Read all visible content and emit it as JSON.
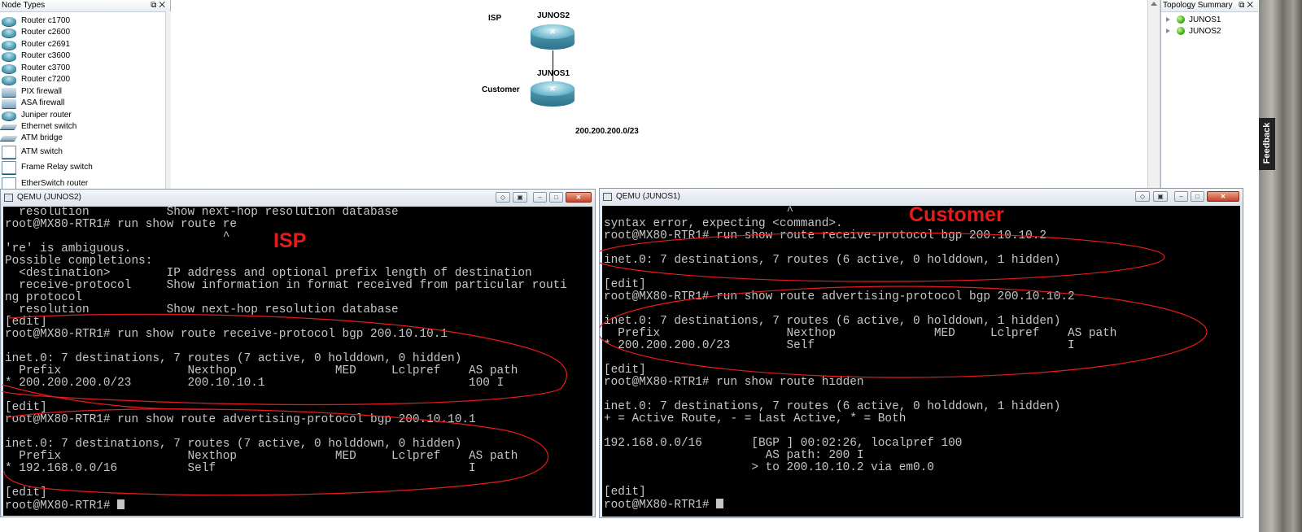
{
  "node_types": {
    "title": "Node Types",
    "items": [
      {
        "label": "Router c1700",
        "icon": "router-icon"
      },
      {
        "label": "Router c2600",
        "icon": "router-icon"
      },
      {
        "label": "Router c2691",
        "icon": "router-icon"
      },
      {
        "label": "Router c3600",
        "icon": "router-icon"
      },
      {
        "label": "Router c3700",
        "icon": "router-icon"
      },
      {
        "label": "Router c7200",
        "icon": "router-icon"
      },
      {
        "label": "PIX firewall",
        "icon": "firewall-icon"
      },
      {
        "label": "ASA firewall",
        "icon": "firewall-icon"
      },
      {
        "label": "Juniper router",
        "icon": "router-icon"
      },
      {
        "label": "Ethernet switch",
        "icon": "switch-icon"
      },
      {
        "label": "ATM bridge",
        "icon": "bridge-icon"
      },
      {
        "label": "ATM switch",
        "icon": "atm-switch-icon"
      },
      {
        "label": "Frame Relay switch",
        "icon": "frame-relay-icon"
      },
      {
        "label": "EtherSwitch router",
        "icon": "etherswitch-icon"
      }
    ]
  },
  "topology_summary": {
    "title": "Topology Summary",
    "items": [
      {
        "label": "JUNOS1",
        "status_color": "#33a000"
      },
      {
        "label": "JUNOS2",
        "status_color": "#33a000"
      }
    ]
  },
  "feedback": {
    "label": "Feedback"
  },
  "topology": {
    "routers": [
      {
        "name": "JUNOS2",
        "role": "ISP"
      },
      {
        "name": "JUNOS1",
        "role": "Customer"
      }
    ],
    "prefix_note": "200.200.200.0/23"
  },
  "qemu_left": {
    "title": "QEMU (JUNOS2)",
    "annotation": "ISP",
    "lines": [
      "  resolution           Show next-hop resolution database",
      "root@MX80-RTR1# run show route re",
      "                               ^",
      "'re' is ambiguous.",
      "Possible completions:",
      "  <destination>        IP address and optional prefix length of destination",
      "  receive-protocol     Show information in format received from particular routi",
      "ng protocol",
      "  resolution           Show next-hop resolution database",
      "[edit]",
      "root@MX80-RTR1# run show route receive-protocol bgp 200.10.10.1",
      "",
      "inet.0: 7 destinations, 7 routes (7 active, 0 holddown, 0 hidden)",
      "  Prefix                  Nexthop              MED     Lclpref    AS path",
      "* 200.200.200.0/23        200.10.10.1                             100 I",
      "",
      "[edit]",
      "root@MX80-RTR1# run show route advertising-protocol bgp 200.10.10.1",
      "",
      "inet.0: 7 destinations, 7 routes (7 active, 0 holddown, 0 hidden)",
      "  Prefix                  Nexthop              MED     Lclpref    AS path",
      "* 192.168.0.0/16          Self                                    I",
      "",
      "[edit]",
      "root@MX80-RTR1# "
    ]
  },
  "qemu_right": {
    "title": "QEMU (JUNOS1)",
    "annotation": "Customer",
    "lines": [
      "                          ^",
      "syntax error, expecting <command>.",
      "root@MX80-RTR1# run show route receive-protocol bgp 200.10.10.2",
      "",
      "inet.0: 7 destinations, 7 routes (6 active, 0 holddown, 1 hidden)",
      "",
      "[edit]",
      "root@MX80-RTR1# run show route advertising-protocol bgp 200.10.10.2",
      "",
      "inet.0: 7 destinations, 7 routes (6 active, 0 holddown, 1 hidden)",
      "  Prefix                  Nexthop              MED     Lclpref    AS path",
      "* 200.200.200.0/23        Self                                    I",
      "",
      "[edit]",
      "root@MX80-RTR1# run show route hidden",
      "",
      "inet.0: 7 destinations, 7 routes (6 active, 0 holddown, 1 hidden)",
      "+ = Active Route, - = Last Active, * = Both",
      "",
      "192.168.0.0/16       [BGP ] 00:02:26, localpref 100",
      "                       AS path: 200 I",
      "                     > to 200.10.10.2 via em0.0",
      "",
      "[edit]",
      "root@MX80-RTR1# "
    ]
  },
  "colors": {
    "annotation": "#e81b1b",
    "terminal_bg": "#000000",
    "terminal_fg": "#c6c6c6"
  }
}
